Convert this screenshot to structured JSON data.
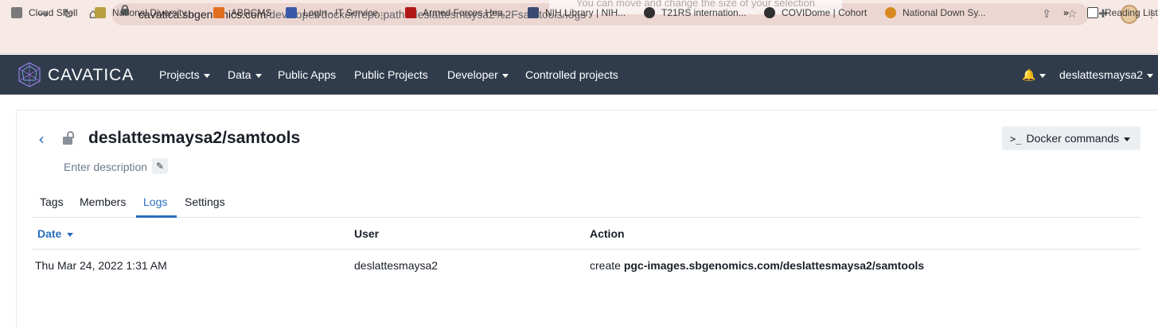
{
  "browser": {
    "url_host": "cavatica.sbgenomics.com",
    "url_path": "/developer/docker/repo;path=deslattesmaysa2%2Fsamtools/logs",
    "tooltip": "You can move and change the size of your selection",
    "bookmarks": [
      {
        "label": "Cloud Shell",
        "color": "#7a7a7a"
      },
      {
        "label": "National Diversity...",
        "color": "#b8a040"
      },
      {
        "label": "ABRCMS",
        "color": "#e07020"
      },
      {
        "label": "Login - IT Service...",
        "color": "#3a5aa8"
      },
      {
        "label": "Armed Forces Hea...",
        "color": "#b01818"
      },
      {
        "label": "NIH Library | NIH...",
        "color": "#3a4a70"
      },
      {
        "label": "T21RS internation...",
        "color": "#303030"
      },
      {
        "label": "COVIDome | Cohort",
        "color": "#303030"
      },
      {
        "label": "National Down Sy...",
        "color": "#d88a20"
      }
    ],
    "overflow": "»",
    "reading_list": "Reading List"
  },
  "header": {
    "logo": "CAVATICA",
    "nav": [
      {
        "label": "Projects",
        "dropdown": true
      },
      {
        "label": "Data",
        "dropdown": true
      },
      {
        "label": "Public Apps",
        "dropdown": false
      },
      {
        "label": "Public Projects",
        "dropdown": false
      },
      {
        "label": "Developer",
        "dropdown": true
      },
      {
        "label": "Controlled projects",
        "dropdown": false
      }
    ],
    "username": "deslattesmaysa2"
  },
  "repo": {
    "title": "deslattesmaysa2/samtools",
    "description_placeholder": "Enter description",
    "docker_button": "Docker commands"
  },
  "tabs": [
    "Tags",
    "Members",
    "Logs",
    "Settings"
  ],
  "active_tab": "Logs",
  "table": {
    "headers": {
      "date": "Date",
      "user": "User",
      "action": "Action"
    },
    "rows": [
      {
        "date": "Thu Mar 24, 2022 1:31 AM",
        "user": "deslattesmaysa2",
        "action_verb": "create",
        "action_target": "pgc-images.sbgenomics.com/deslattesmaysa2/samtools"
      }
    ]
  },
  "colors": {
    "header_bg": "#303c4c",
    "accent": "#2a6fbe"
  }
}
